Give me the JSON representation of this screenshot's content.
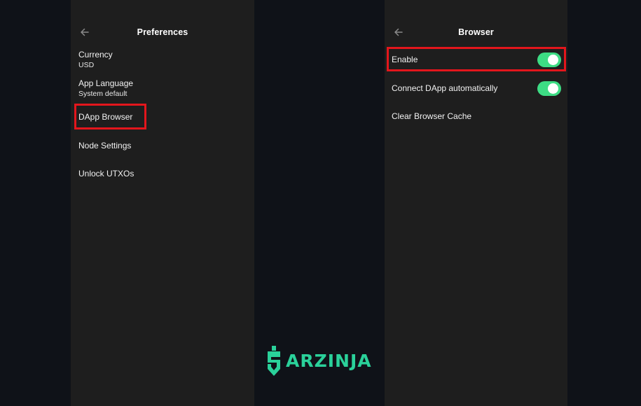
{
  "colors": {
    "background": "#0f1218",
    "panel": "#1e1e1e",
    "highlight": "#e3161c",
    "toggle_on": "#3ddc84",
    "brand": "#2ad19a"
  },
  "preferences_screen": {
    "back_icon": "arrow-left-icon",
    "title": "Preferences",
    "items": [
      {
        "label": "Currency",
        "value": "USD"
      },
      {
        "label": "App Language",
        "value": "System default"
      },
      {
        "label": "DApp Browser",
        "highlighted": true
      },
      {
        "label": "Node Settings"
      },
      {
        "label": "Unlock UTXOs"
      }
    ]
  },
  "browser_screen": {
    "back_icon": "arrow-left-icon",
    "title": "Browser",
    "rows": [
      {
        "label": "Enable",
        "toggle": true,
        "on": true,
        "highlighted": true
      },
      {
        "label": "Connect DApp automatically",
        "toggle": true,
        "on": true
      },
      {
        "label": "Clear Browser Cache"
      }
    ]
  },
  "watermark": {
    "text": "ARZINJA",
    "icon": "dollar-shield-icon"
  }
}
